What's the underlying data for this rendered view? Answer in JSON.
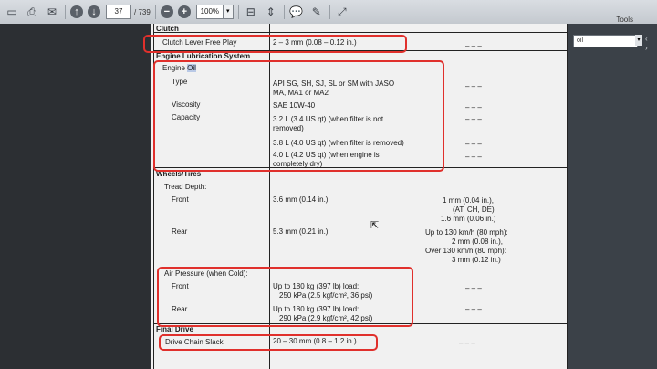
{
  "toolbar": {
    "page_current": "37",
    "page_total": "/ 739",
    "zoom": "100%",
    "tools_label": "Tools"
  },
  "search": {
    "value": "oil"
  },
  "doc": {
    "clutch": {
      "section": "Clutch",
      "free_play_label": "Clutch Lever Free Play",
      "free_play_value": "2 – 3 mm (0.08 – 0.12 in.)",
      "free_play_limit": "– – –"
    },
    "lube": {
      "section": "Engine Lubrication System",
      "engine_oil_prefix": "Engine ",
      "engine_oil_highlight": "Oil",
      "type_label": "Type",
      "type_value_1": "API SG, SH, SJ, SL or SM with JASO",
      "type_value_2": "MA, MA1 or MA2",
      "viscosity_label": "Viscosity",
      "viscosity_value": "SAE 10W-40",
      "capacity_label": "Capacity",
      "cap1_line1": "3.2 L (3.4 US qt) (when filter is not",
      "cap1_line2": "removed)",
      "cap2": "3.8 L (4.0 US qt) (when filter is removed)",
      "cap3_line1": "4.0 L (4.2 US qt) (when engine is",
      "cap3_line2": "completely dry)",
      "dash": "– – –"
    },
    "wheels": {
      "section": "Wheels/Tires",
      "tread_label": "Tread Depth:",
      "front_label": "Front",
      "front_value": "3.6 mm (0.14 in.)",
      "front_limit_1": "1 mm (0.04 in.),",
      "front_limit_2": "(AT, CH, DE)",
      "front_limit_3": "1.6 mm (0.06 in.)",
      "rear_label": "Rear",
      "rear_value": "5.3 mm (0.21 in.)",
      "rear_limit_1": "Up to 130 km/h (80 mph):",
      "rear_limit_2": "2 mm (0.08 in.),",
      "rear_limit_3": "Over 130 km/h (80 mph):",
      "rear_limit_4": "3 mm (0.12 in.)",
      "air_label": "Air Pressure (when Cold):",
      "air_front_label": "Front",
      "air_front_1": "Up to 180 kg (397 lb) load:",
      "air_front_2": "250 kPa (2.5 kgf/cm², 36 psi)",
      "air_rear_label": "Rear",
      "air_rear_1": "Up to 180 kg (397 lb) load:",
      "air_rear_2": "290 kPa (2.9 kgf/cm², 42 psi)",
      "dash": "– – –"
    },
    "final_drive": {
      "section": "Final Drive",
      "chain_label": "Drive Chain Slack",
      "chain_value": "20 – 30 mm (0.8 – 1.2 in.)",
      "chain_limit": "– – –"
    }
  }
}
